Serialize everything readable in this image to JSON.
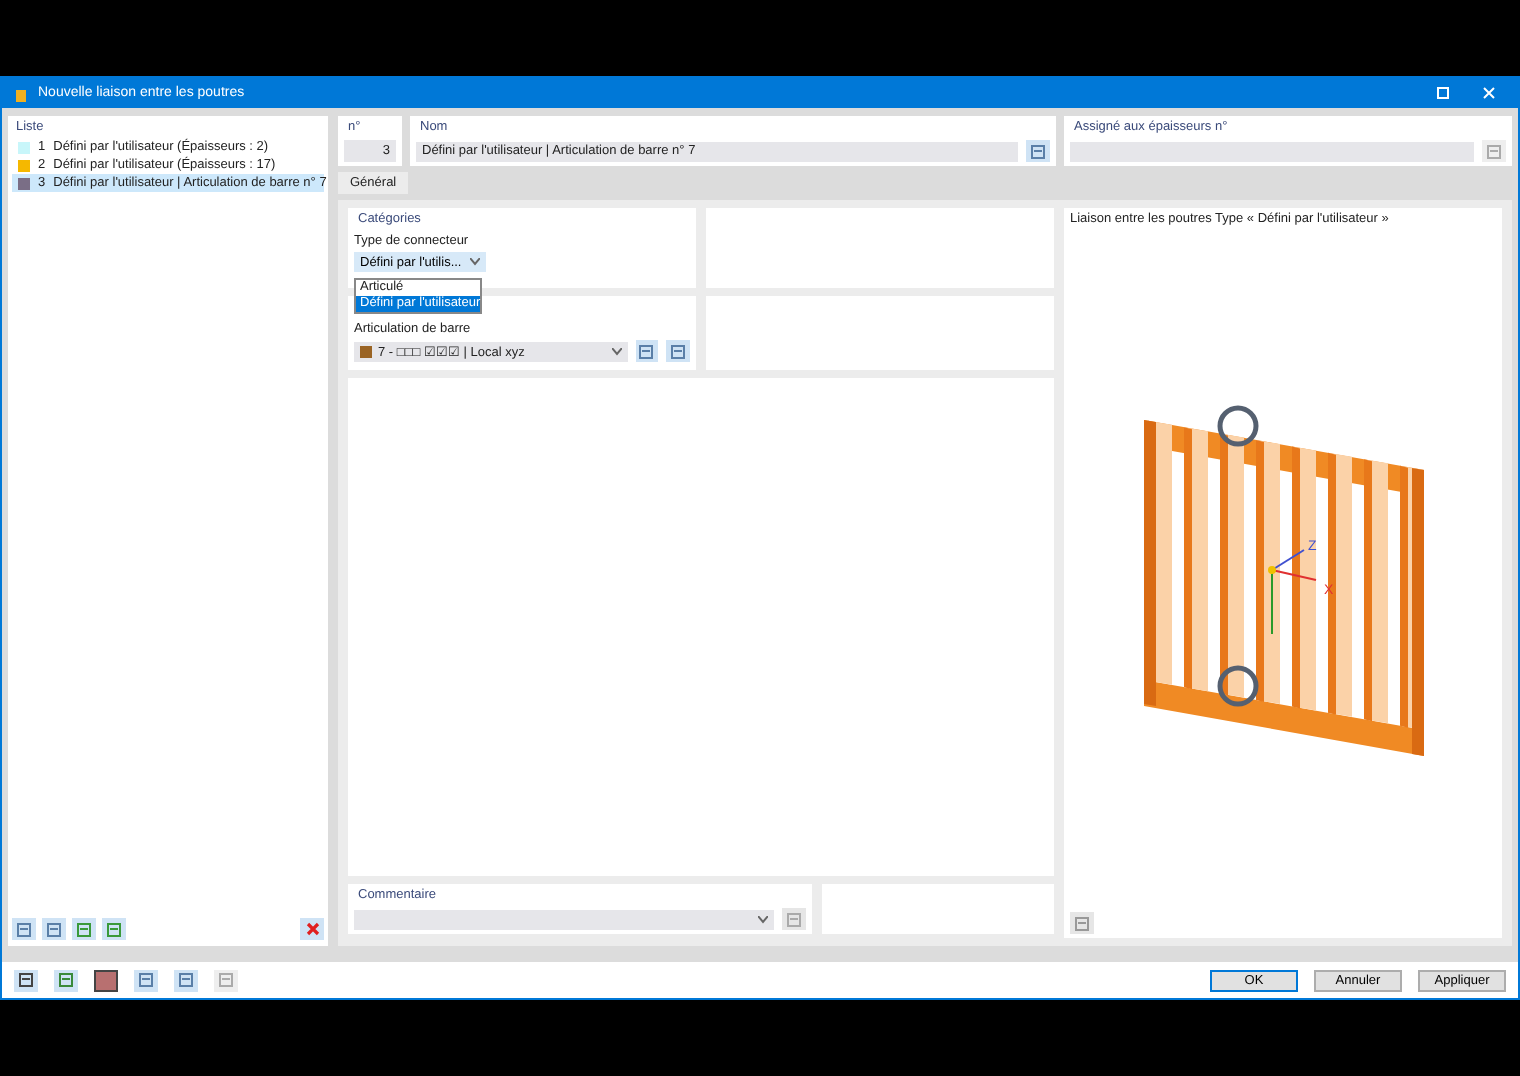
{
  "window": {
    "title": "Nouvelle liaison entre les poutres"
  },
  "list": {
    "heading": "Liste",
    "items": [
      {
        "number": "1",
        "label": "Défini par l'utilisateur (Épaisseurs : 2)",
        "color": "#c8f6fa",
        "selected": false
      },
      {
        "number": "2",
        "label": "Défini par l'utilisateur (Épaisseurs : 17)",
        "color": "#f5b800",
        "selected": false
      },
      {
        "number": "3",
        "label": "Défini par l'utilisateur | Articulation de barre n° 7",
        "color": "#7a6e86",
        "selected": true
      }
    ]
  },
  "number": {
    "label": "n°",
    "value": "3"
  },
  "name": {
    "label": "Nom",
    "value": "Défini par l'utilisateur | Articulation de barre n° 7"
  },
  "assigned": {
    "label": "Assigné aux épaisseurs n°"
  },
  "tabs": [
    {
      "label": "Général",
      "selected": true
    }
  ],
  "categories": {
    "heading": "Catégories",
    "connector_type_label": "Type de connecteur",
    "connector_type_value": "Défini par l'utilis...",
    "options": [
      {
        "label": "Articulé",
        "selected": false
      },
      {
        "label": "Défini par l'utilisateur",
        "selected": true
      }
    ]
  },
  "member_hinge": {
    "label": "Articulation de barre",
    "value": "7 - □□□ ☑☑☑ | Local xyz",
    "color": "#9a6424"
  },
  "comment": {
    "label": "Commentaire"
  },
  "preview": {
    "title": "Liaison entre les poutres Type « Défini par l'utilisateur »",
    "axis_z": "Z",
    "axis_x": "X"
  },
  "buttons": [
    {
      "label": "OK",
      "kind": "primary"
    },
    {
      "label": "Annuler",
      "kind": "normal"
    },
    {
      "label": "Appliquer",
      "kind": "normal"
    }
  ]
}
